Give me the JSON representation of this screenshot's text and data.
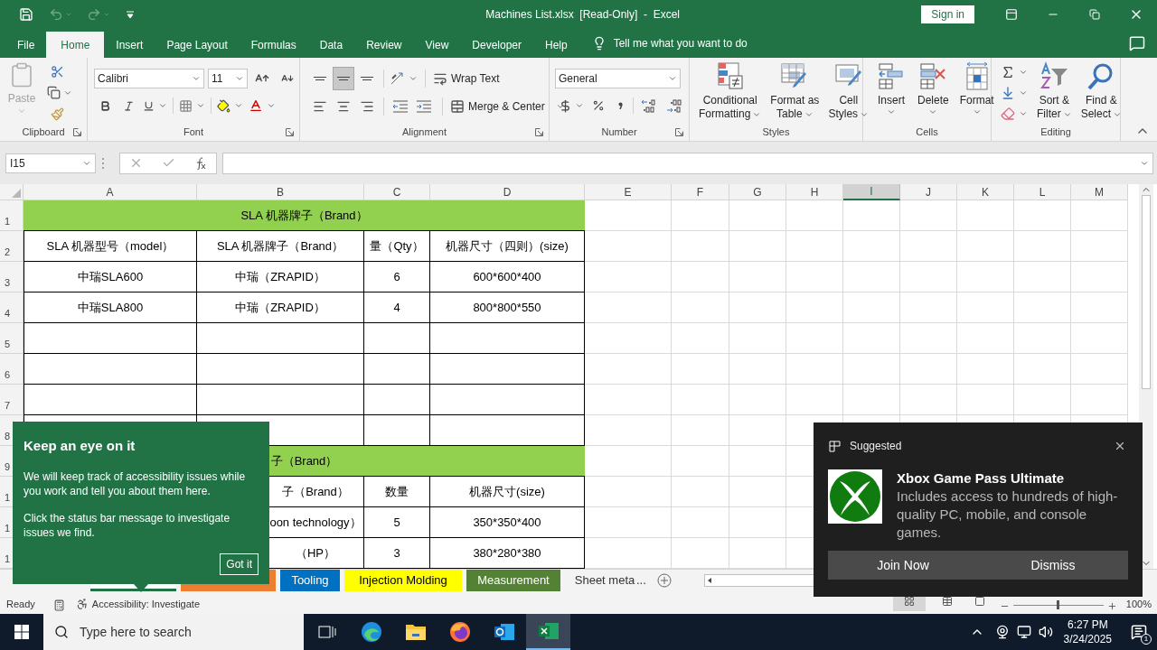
{
  "window": {
    "title": "Machines List.xlsx  [Read-Only]  -  Excel",
    "sign_in": "Sign in"
  },
  "menu_tabs": [
    {
      "label": "File",
      "selected": false
    },
    {
      "label": "Home",
      "selected": true
    },
    {
      "label": "Insert",
      "selected": false
    },
    {
      "label": "Page Layout",
      "selected": false
    },
    {
      "label": "Formulas",
      "selected": false
    },
    {
      "label": "Data",
      "selected": false
    },
    {
      "label": "Review",
      "selected": false
    },
    {
      "label": "View",
      "selected": false
    },
    {
      "label": "Developer",
      "selected": false
    },
    {
      "label": "Help",
      "selected": false
    }
  ],
  "tell_me": "Tell me what you want to do",
  "ribbon": {
    "clipboard": {
      "label": "Clipboard",
      "paste": {
        "label": "Paste",
        "disabled": true
      }
    },
    "font": {
      "label": "Font",
      "name": "Calibri",
      "size": "11"
    },
    "alignment": {
      "label": "Alignment",
      "vertical_align": [
        {
          "selected": false
        },
        {
          "selected": true
        },
        {
          "selected": false
        }
      ],
      "wrap_text": "Wrap Text",
      "merge": "Merge & Center"
    },
    "number": {
      "label": "Number",
      "format": "General"
    },
    "styles": {
      "label": "Styles",
      "buttons": [
        {
          "lines": [
            "Conditional",
            "Formatting"
          ],
          "kind": "conditional"
        },
        {
          "lines": [
            "Format as",
            "Table"
          ],
          "kind": "table"
        },
        {
          "lines": [
            "Cell",
            "Styles"
          ],
          "kind": "cellstyles"
        }
      ]
    },
    "cells": {
      "label": "Cells",
      "buttons": [
        {
          "label": "Insert",
          "kind": "insert"
        },
        {
          "label": "Delete",
          "kind": "delete"
        },
        {
          "label": "Format",
          "kind": "format"
        }
      ]
    },
    "editing": {
      "label": "Editing",
      "buttons": [
        {
          "lines": [
            "Sort &",
            "Filter"
          ],
          "kind": "sort"
        },
        {
          "lines": [
            "Find &",
            "Select"
          ],
          "kind": "find"
        }
      ]
    }
  },
  "formula_bar": {
    "name_box": "I15"
  },
  "sheet": {
    "columns": [
      {
        "label": "A",
        "selected": false
      },
      {
        "label": "B",
        "selected": false
      },
      {
        "label": "C",
        "selected": false
      },
      {
        "label": "D",
        "selected": false
      },
      {
        "label": "E",
        "selected": false
      },
      {
        "label": "F",
        "selected": false
      },
      {
        "label": "G",
        "selected": false
      },
      {
        "label": "H",
        "selected": false
      },
      {
        "label": "I",
        "selected": true
      },
      {
        "label": "J",
        "selected": false
      },
      {
        "label": "K",
        "selected": false
      },
      {
        "label": "L",
        "selected": false
      },
      {
        "label": "M",
        "selected": false
      }
    ],
    "rows": [
      {
        "header": "1",
        "kind": "band",
        "text": "SLA 机器牌子（Brand）"
      },
      {
        "header": "2",
        "kind": "data",
        "cells": [
          "SLA 机器型号（model）",
          "SLA 机器牌子（Brand）",
          "量（Qty）",
          "机器尺寸（四则）(size)"
        ]
      },
      {
        "header": "3",
        "kind": "data",
        "cells": [
          "中瑞SLA600",
          "中瑞（ZRAPID）",
          "6",
          "600*600*400"
        ]
      },
      {
        "header": "4",
        "kind": "data",
        "cells": [
          "中瑞SLA800",
          "中瑞（ZRAPID）",
          "4",
          "800*800*550"
        ]
      },
      {
        "header": "5",
        "kind": "blank"
      },
      {
        "header": "6",
        "kind": "blank"
      },
      {
        "header": "7",
        "kind": "blank"
      },
      {
        "header": "8",
        "kind": "blank"
      },
      {
        "header": "9",
        "kind": "band",
        "text": "子（Brand）"
      },
      {
        "header": "1",
        "kind": "covered",
        "cells": [
          "子（Brand）",
          "数量",
          "机器尺寸(size)"
        ]
      },
      {
        "header": "1",
        "kind": "covered",
        "cells": [
          "oon technology）",
          "5",
          "350*350*400"
        ]
      },
      {
        "header": "1",
        "kind": "covered",
        "cells": [
          "（HP）",
          "3",
          "380*280*380"
        ]
      }
    ]
  },
  "sheet_tabs": [
    {
      "color": "#217346",
      "selected": true
    },
    {
      "color": "#ed7d31",
      "selected": false
    },
    {
      "label": "Tooling",
      "color": "#0070c0",
      "selected": false
    },
    {
      "label": "Injection Molding",
      "color": "#ffff00",
      "selected": false
    },
    {
      "label": "Measurement",
      "color": "#548235",
      "selected": false
    },
    {
      "label": "Sheet meta",
      "selected": false
    }
  ],
  "more_tabs": "...",
  "status_bar": {
    "ready": "Ready",
    "accessibility": "Accessibility: Investigate",
    "zoom_slider": {
      "level": 0.5
    },
    "zoom": "100%"
  },
  "accessibility_tip": {
    "title": "Keep an eye on it",
    "paragraphs": [
      "We will keep track of accessibility issues while you work and tell you about them here.",
      "Click the status bar message to investigate issues we find."
    ],
    "button": "Got it"
  },
  "notification": {
    "header": "Suggested",
    "title": "Xbox Game Pass Ultimate",
    "body": "Includes access to hundreds of high-quality PC, mobile, and console games.",
    "buttons": [
      "Join Now",
      "Dismiss"
    ]
  },
  "taskbar": {
    "search_placeholder": "Type here to search",
    "apps": [
      {
        "kind": "taskview",
        "selected": false
      },
      {
        "kind": "edge",
        "selected": false
      },
      {
        "kind": "explorer",
        "selected": false
      },
      {
        "kind": "firefox",
        "selected": false
      },
      {
        "kind": "outlook",
        "selected": false
      },
      {
        "kind": "excel",
        "selected": true
      }
    ],
    "time": "6:27 PM",
    "date": "3/24/2025",
    "notifications": "1"
  }
}
